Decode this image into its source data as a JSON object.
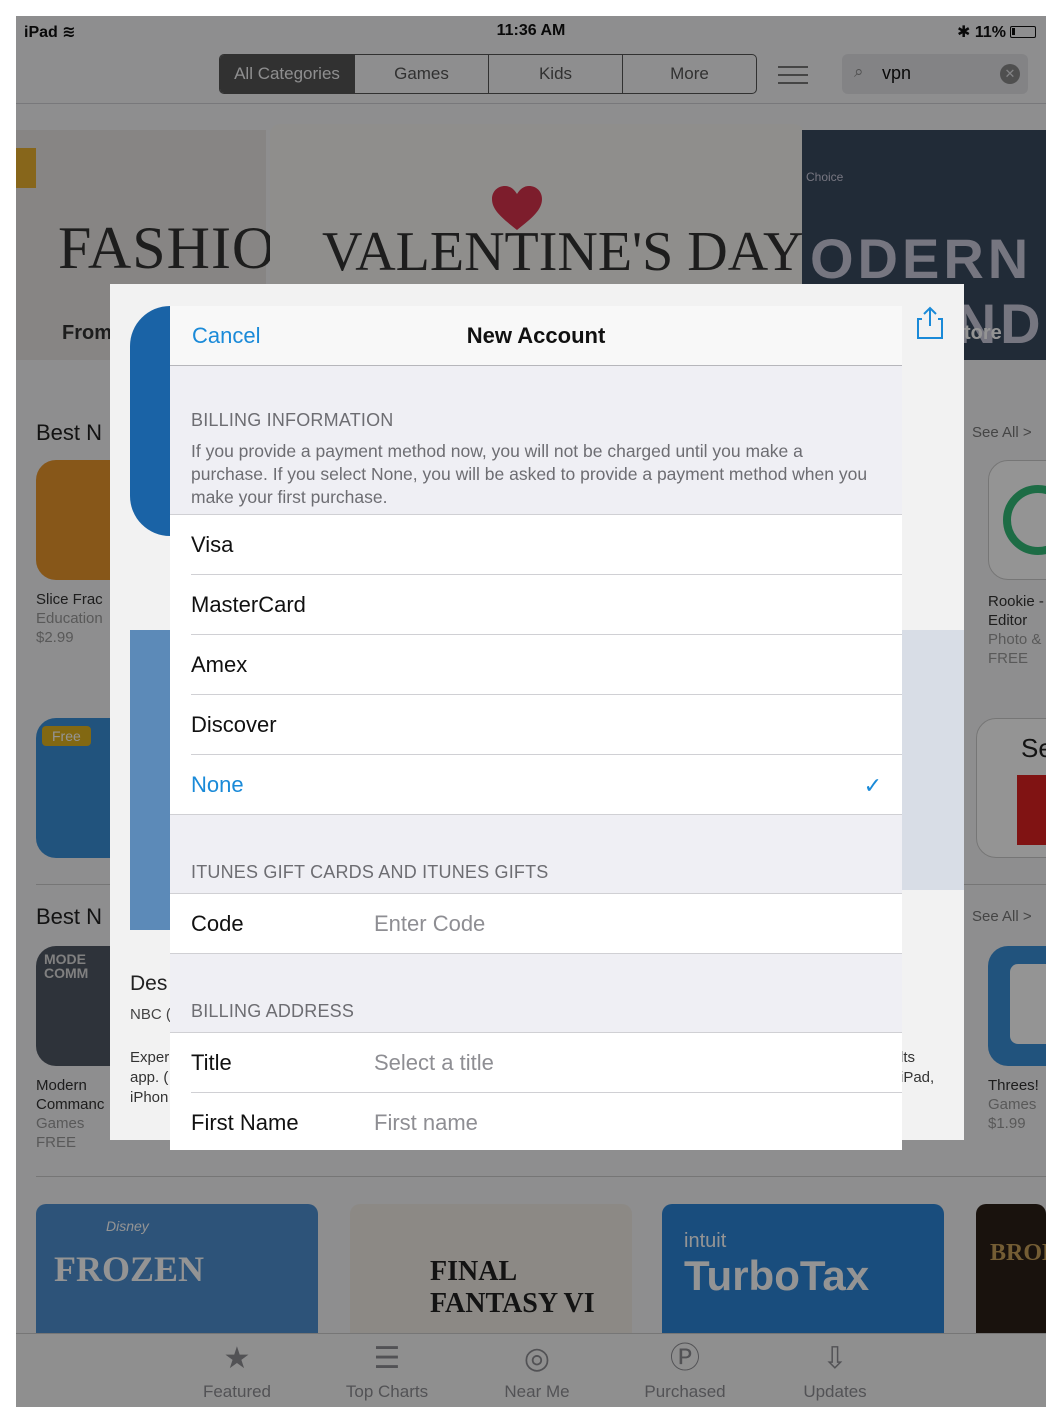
{
  "status_bar": {
    "device": "iPad",
    "wifi": "Ὥc",
    "time": "11:36 AM",
    "bluetooth": "✱",
    "battery": "11%"
  },
  "nav": {
    "segments": [
      "All Categories",
      "Games",
      "Kids",
      "More"
    ],
    "search_query": "vpn"
  },
  "banners": {
    "fashion": "FASHION",
    "valentine": "VALENTINE'S DAY",
    "modern": "ODERN MMAND",
    "choice": "Choice",
    "from": "From",
    "store_suffix": "tore"
  },
  "sections": [
    {
      "title": "Best N",
      "see_all": "See All >"
    },
    {
      "title": "Best N",
      "see_all": "See All >"
    }
  ],
  "apps": {
    "slice": {
      "name": "Slice Frac",
      "category": "Education",
      "price": "$2.99"
    },
    "free_badge": "Free",
    "rookie": {
      "name": "Rookie -",
      "name2": "Editor",
      "category": "Photo &",
      "price": "FREE"
    },
    "se": "Se",
    "modern": {
      "name": "Modern",
      "name2": "Commanc",
      "category": "Games",
      "price": "FREE"
    },
    "modern_icon_text": "MODE COMM",
    "threes": {
      "name": "Threes!",
      "category": "Games",
      "price": "$1.99"
    }
  },
  "under_sheet": {
    "des": "Des",
    "nbc": "NBC (",
    "exp_line1": "Exper",
    "exp_line2": "app. (",
    "exp_line3": "iPhon",
    "its_line1": "lts",
    "its_line2": "iPad,"
  },
  "promos": [
    "FROZEN",
    "FINAL FANTASY VI",
    "TurboTax",
    "BROK"
  ],
  "promo_extras": {
    "disney": "Disney",
    "intuit": "intuit"
  },
  "tabbar": [
    {
      "label": "Featured",
      "icon": "star-icon"
    },
    {
      "label": "Top Charts",
      "icon": "list-icon"
    },
    {
      "label": "Near Me",
      "icon": "location-icon"
    },
    {
      "label": "Purchased",
      "icon": "purchased-icon"
    },
    {
      "label": "Updates",
      "icon": "updates-icon"
    }
  ],
  "modal": {
    "cancel": "Cancel",
    "title": "New Account",
    "billing_header": "BILLING INFORMATION",
    "billing_desc": "If you provide a payment method now, you will not be charged until you make a purchase. If you select None, you will be asked to provide a payment method when you make your first purchase.",
    "payment_options": [
      "Visa",
      "MasterCard",
      "Amex",
      "Discover",
      "None"
    ],
    "selected_payment": "None",
    "gift_header": "ITUNES GIFT CARDS AND ITUNES GIFTS",
    "code": {
      "label": "Code",
      "placeholder": "Enter Code"
    },
    "address_header": "BILLING ADDRESS",
    "title_field": {
      "label": "Title",
      "placeholder": "Select a title"
    },
    "first_name": {
      "label": "First Name",
      "placeholder": "First name"
    }
  },
  "colors": {
    "accent": "#1a8ad8",
    "dim": "rgba(0,0,0,0.42)",
    "group_bg": "#efeff4"
  }
}
